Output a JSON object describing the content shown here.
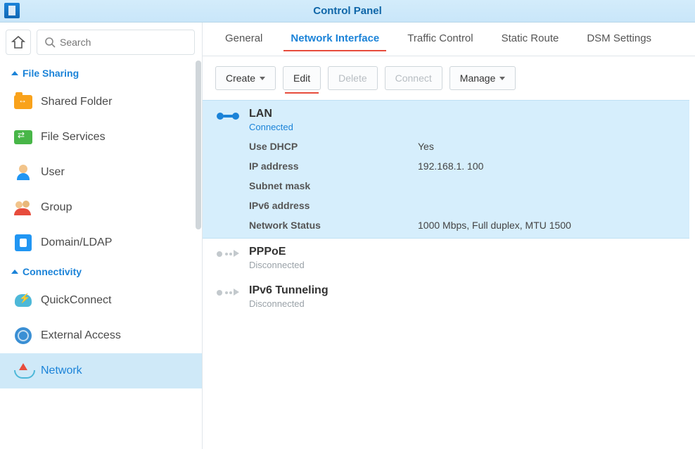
{
  "window_title": "Control Panel",
  "search_placeholder": "Search",
  "sections": {
    "file_sharing": {
      "label": "File Sharing"
    },
    "connectivity": {
      "label": "Connectivity"
    }
  },
  "nav": {
    "shared_folder": "Shared Folder",
    "file_services": "File Services",
    "user": "User",
    "group": "Group",
    "domain_ldap": "Domain/LDAP",
    "quickconnect": "QuickConnect",
    "external_access": "External Access",
    "network": "Network"
  },
  "tabs": {
    "general": "General",
    "network_interface": "Network Interface",
    "traffic_control": "Traffic Control",
    "static_route": "Static Route",
    "dsm_settings": "DSM Settings"
  },
  "toolbar": {
    "create": "Create",
    "edit": "Edit",
    "delete": "Delete",
    "connect": "Connect",
    "manage": "Manage"
  },
  "interfaces": {
    "lan": {
      "name": "LAN",
      "status": "Connected",
      "fields": {
        "use_dhcp_label": "Use DHCP",
        "use_dhcp_value": "Yes",
        "ip_label": "IP address",
        "ip_value": "192.168.1. 100",
        "subnet_label": "Subnet mask",
        "subnet_value": "",
        "ipv6_label": "IPv6 address",
        "ipv6_value": "",
        "netstatus_label": "Network Status",
        "netstatus_value": "1000 Mbps, Full duplex, MTU 1500"
      }
    },
    "pppoe": {
      "name": "PPPoE",
      "status": "Disconnected"
    },
    "ipv6": {
      "name": "IPv6 Tunneling",
      "status": "Disconnected"
    }
  }
}
